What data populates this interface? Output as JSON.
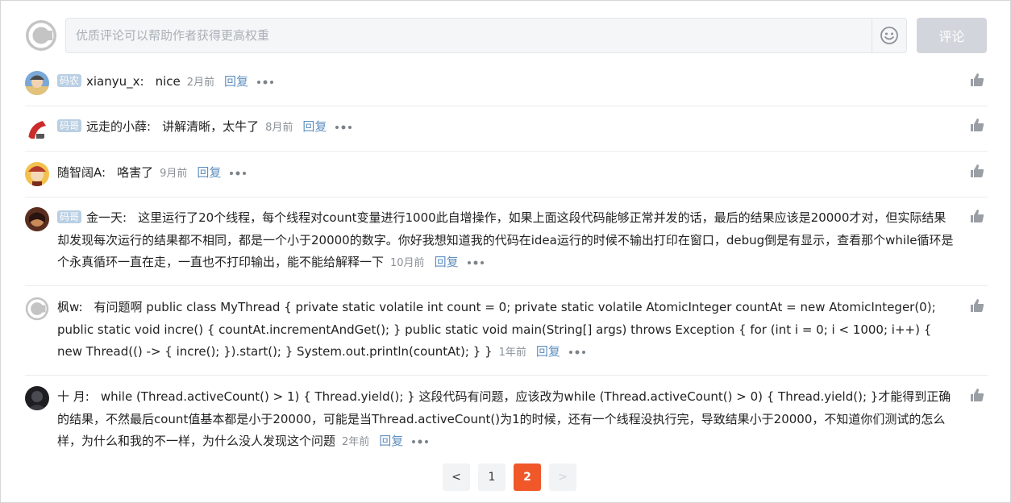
{
  "composer": {
    "placeholder": "优质评论可以帮助作者获得更高权重",
    "submit_label": "评论"
  },
  "comments": [
    {
      "badge": "码农",
      "username": "xianyu_x",
      "text": "nice",
      "time": "2月前",
      "reply": "回复"
    },
    {
      "badge": "码哥",
      "username": "远走的小薛",
      "text": "讲解清晰，太牛了",
      "time": "8月前",
      "reply": "回复"
    },
    {
      "badge": "",
      "username": "随智阔A",
      "text": "咯害了",
      "time": "9月前",
      "reply": "回复"
    },
    {
      "badge": "码哥",
      "username": "金一天",
      "text": "这里运行了20个线程，每个线程对count变量进行1000此自增操作，如果上面这段代码能够正常并发的话，最后的结果应该是20000才对，但实际结果却发现每次运行的结果都不相同，都是一个小于20000的数字。你好我想知道我的代码在idea运行的时候不输出打印在窗口，debug倒是有显示，查看那个while循环是个永真循环一直在走，一直也不打印输出，能不能给解释一下",
      "time": "10月前",
      "reply": "回复"
    },
    {
      "badge": "",
      "username": "枫w",
      "text": "有问题啊 public class MyThread { private static volatile int count = 0; private static volatile AtomicInteger countAt = new AtomicInteger(0); public static void incre() { countAt.incrementAndGet(); } public static void main(String[] args) throws Exception { for (int i = 0; i < 1000; i++) { new Thread(() -> { incre(); }).start(); } System.out.println(countAt); } }",
      "time": "1年前",
      "reply": "回复"
    },
    {
      "badge": "",
      "username": "十 月",
      "text": "while (Thread.activeCount() > 1) { Thread.yield(); } 这段代码有问题，应该改为while (Thread.activeCount() > 0) { Thread.yield(); }才能得到正确的结果，不然最后count值基本都是小于20000，可能是当Thread.activeCount()为1的时候，还有一个线程没执行完，导致结果小于20000，不知道你们测试的怎么样，为什么和我的不一样，为什么没人发现这个问题",
      "time": "2年前",
      "reply": "回复"
    }
  ],
  "pagination": {
    "prev": "<",
    "pages": [
      "1",
      "2"
    ],
    "current": "2",
    "next": ">"
  }
}
